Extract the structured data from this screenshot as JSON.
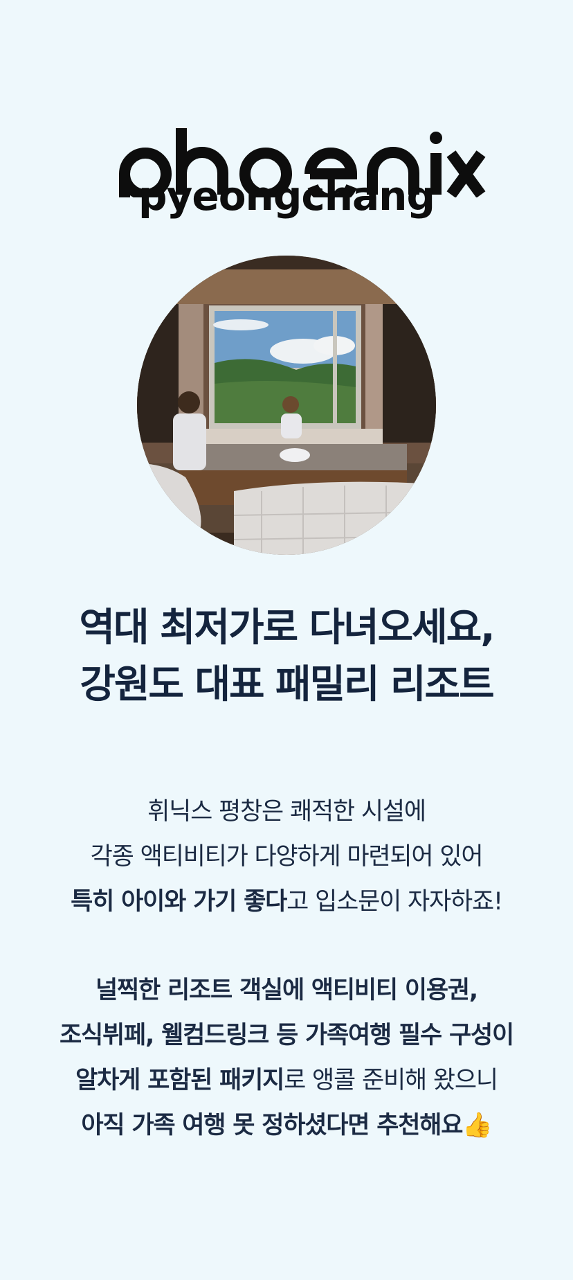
{
  "logo": {
    "brand": "phoenix",
    "location": "pyeongchang"
  },
  "headline": {
    "line1": "역대 최저가로 다녀오세요,",
    "line2": "강원도 대표 패밀리 리조트"
  },
  "intro": {
    "line1": "휘닉스 평창은 쾌적한 시설에",
    "line2": "각종 액티비티가 다양하게 마련되어 있어",
    "line3_bold": "특히 아이와 가기 좋다",
    "line3_rest": "고 입소문이 자자하죠!"
  },
  "package": {
    "line1": "널찍한 리조트 객실에 액티비티 이용권,",
    "line2": "조식뷔페, 웰컴드링크 등 가족여행 필수 구성이",
    "line3_bold": "알차게 포함된 패키지",
    "line3_rest": "로 앵콜 준비해 왔으니",
    "line4": "아직 가족 여행 못 정하셨다면 추천해요",
    "emoji": "👍"
  }
}
